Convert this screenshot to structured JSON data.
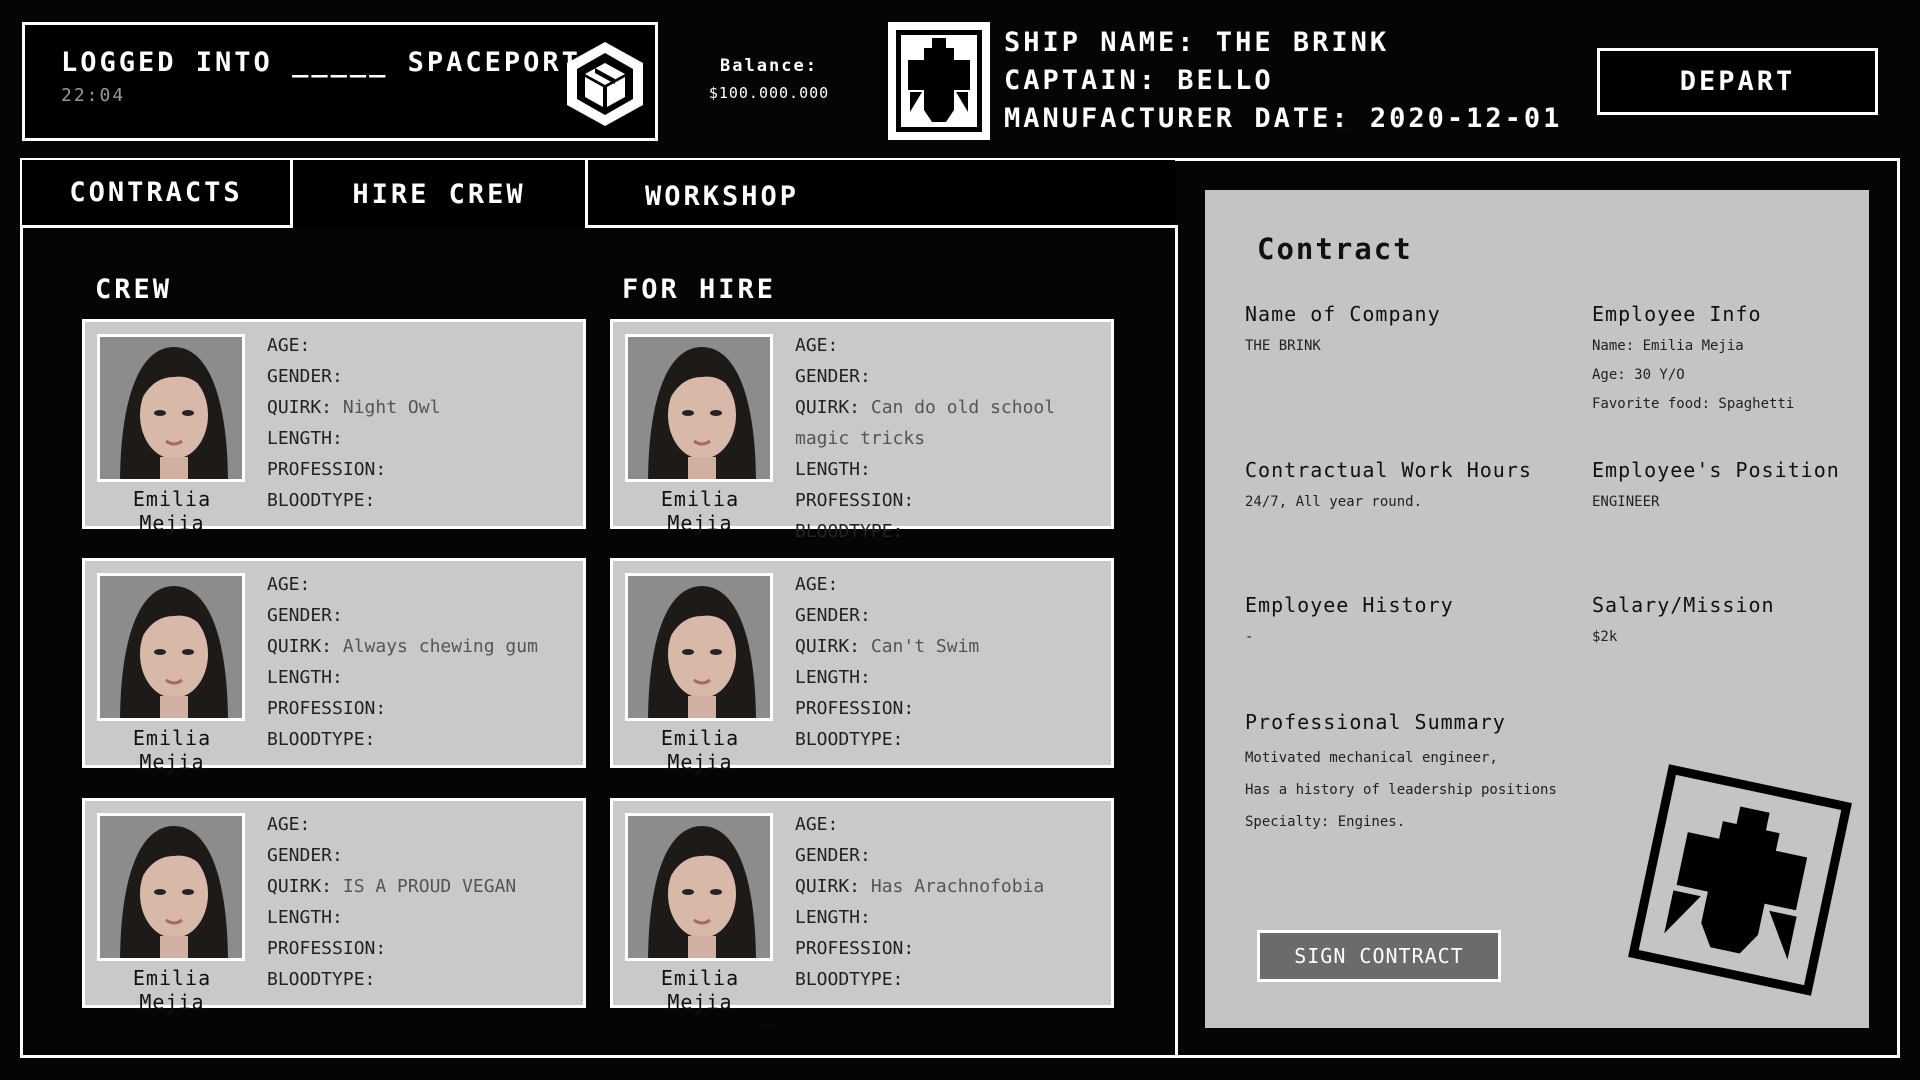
{
  "header": {
    "login_text": "LOGGED INTO _____ SPACEPORT",
    "time": "22:04",
    "balance_label": "Balance:",
    "balance_value": "$100.000.000",
    "ship_name": "SHIP NAME: THE BRINK",
    "captain": "CAPTAIN: BELLO",
    "manufacturer_date": "MANUFACTURER DATE: 2020-12-01",
    "depart_label": "DEPART"
  },
  "tabs": [
    {
      "label": "CONTRACTS"
    },
    {
      "label": "HIRE CREW"
    },
    {
      "label": "WORKSHOP"
    }
  ],
  "columns": {
    "crew": "CREW",
    "for_hire": "FOR HIRE"
  },
  "stat_labels": {
    "age": "AGE:",
    "gender": "GENDER:",
    "quirk": "QUIRK:",
    "length": "LENGTH:",
    "profession": "PROFESSION:",
    "bloodtype": "BLOODTYPE:"
  },
  "crew": [
    {
      "name": "Emilia Mejia",
      "quirk": "Night Owl"
    },
    {
      "name": "Emilia Mejia",
      "quirk": "Always chewing gum"
    },
    {
      "name": "Emilia Mejia",
      "quirk": "IS A PROUD VEGAN"
    }
  ],
  "for_hire": [
    {
      "name": "Emilia Mejia",
      "quirk": "Can do old school magic tricks"
    },
    {
      "name": "Emilia Mejia",
      "quirk": "Can't Swim"
    },
    {
      "name": "Emilia Mejia",
      "quirk": "Has Arachnofobia"
    }
  ],
  "contract": {
    "title": "Contract",
    "company_label": "Name of Company",
    "company_value": "THE BRINK",
    "employee_info_label": "Employee Info",
    "employee_name": "Name: Emilia Mejia",
    "employee_age": "Age: 30 Y/O",
    "employee_food": "Favorite food: Spaghetti",
    "hours_label": "Contractual Work Hours",
    "hours_value": "24/7, All year round.",
    "position_label": "Employee's Position",
    "position_value": "ENGINEER",
    "history_label": "Employee History",
    "history_value": "-",
    "salary_label": "Salary/Mission",
    "salary_value": "$2k",
    "summary_label": "Professional Summary",
    "summary_lines": [
      "Motivated mechanical engineer,",
      "Has a history of leadership positions",
      "Specialty: Engines."
    ],
    "sign_label": "SIGN CONTRACT"
  }
}
